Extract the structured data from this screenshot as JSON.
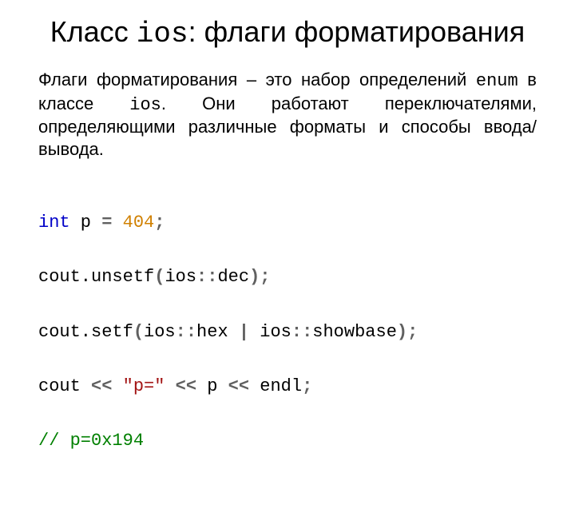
{
  "title": {
    "pre": "Класс ",
    "mono": "ios",
    "post": ": флаги форматирования"
  },
  "paragraph": {
    "t1": "Флаги форматирования – это набор определений ",
    "m1": "enum",
    "t2": " в классе ",
    "m2": "ios",
    "t3": ". Они работают переключателями, определяющими различные форматы и способы ввода/вывода."
  },
  "code": {
    "l1_kw": "int",
    "l1_sp1": " p ",
    "l1_eq": "=",
    "l1_sp2": " ",
    "l1_num": "404",
    "l1_semi": ";",
    "l2_a": "cout.unsetf",
    "l2_open": "(",
    "l2_b": "ios",
    "l2_cc1": "::",
    "l2_c": "dec",
    "l2_close": ");",
    "l3_a": "cout.setf",
    "l3_open": "(",
    "l3_b": "ios",
    "l3_cc1": "::",
    "l3_c": "hex ",
    "l3_pipe": "|",
    "l3_d": " ios",
    "l3_cc2": "::",
    "l3_e": "showbase",
    "l3_close": ");",
    "l4_a": "cout ",
    "l4_s1": "<<",
    "l4_b": " ",
    "l4_str": "\"p=\"",
    "l4_c": " ",
    "l4_s2": "<<",
    "l4_d": " p ",
    "l4_s3": "<<",
    "l4_e": " endl",
    "l4_semi": ";",
    "l5_cmt": "// p=0x194"
  }
}
